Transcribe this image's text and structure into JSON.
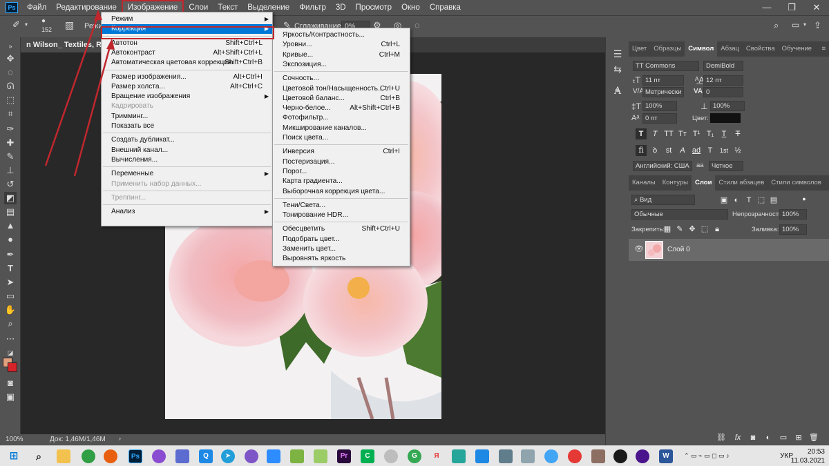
{
  "menubar": {
    "items": [
      "Файл",
      "Редактирование",
      "Изображение",
      "Слои",
      "Текст",
      "Выделение",
      "Фильтр",
      "3D",
      "Просмотр",
      "Окно",
      "Справка"
    ],
    "active_index": 2,
    "logo": "Ps"
  },
  "window_controls": {
    "minimize": "—",
    "maximize": "❐",
    "close": "✕"
  },
  "options_bar": {
    "brush_size": "152",
    "mode_label": "Режим",
    "smoothing_label": "Сглаживание:",
    "smoothing_value": "0%"
  },
  "document_tab": {
    "title": "n Wilson_ Textiles, Rugs, Pil"
  },
  "status_bar": {
    "zoom": "100%",
    "doc_info": "Док: 1,46M/1,46M"
  },
  "image_menu": {
    "items": [
      {
        "label": "Режим",
        "shortcut": "",
        "submenu": true,
        "disabled": false
      },
      {
        "label": "Коррекция",
        "shortcut": "",
        "submenu": true,
        "disabled": false,
        "highlighted": true
      },
      {
        "label": "Автотон",
        "shortcut": "Shift+Ctrl+L",
        "submenu": false,
        "disabled": false
      },
      {
        "label": "Автоконтраст",
        "shortcut": "Alt+Shift+Ctrl+L",
        "submenu": false,
        "disabled": false
      },
      {
        "label": "Автоматическая цветовая коррекция",
        "shortcut": "Shift+Ctrl+B",
        "submenu": false,
        "disabled": false
      },
      {
        "label": "Размер изображения...",
        "shortcut": "Alt+Ctrl+I",
        "submenu": false,
        "disabled": false
      },
      {
        "label": "Размер холста...",
        "shortcut": "Alt+Ctrl+C",
        "submenu": false,
        "disabled": false
      },
      {
        "label": "Вращение изображения",
        "shortcut": "",
        "submenu": true,
        "disabled": false
      },
      {
        "label": "Кадрировать",
        "shortcut": "",
        "submenu": false,
        "disabled": true
      },
      {
        "label": "Тримминг...",
        "shortcut": "",
        "submenu": false,
        "disabled": false
      },
      {
        "label": "Показать все",
        "shortcut": "",
        "submenu": false,
        "disabled": false
      },
      {
        "label": "Создать дубликат...",
        "shortcut": "",
        "submenu": false,
        "disabled": false
      },
      {
        "label": "Внешний канал...",
        "shortcut": "",
        "submenu": false,
        "disabled": false
      },
      {
        "label": "Вычисления...",
        "shortcut": "",
        "submenu": false,
        "disabled": false
      },
      {
        "label": "Переменные",
        "shortcut": "",
        "submenu": true,
        "disabled": false
      },
      {
        "label": "Применить набор данных...",
        "shortcut": "",
        "submenu": false,
        "disabled": true
      },
      {
        "label": "Треппинг...",
        "shortcut": "",
        "submenu": false,
        "disabled": true
      },
      {
        "label": "Анализ",
        "shortcut": "",
        "submenu": true,
        "disabled": false
      }
    ]
  },
  "adjust_menu": {
    "items": [
      {
        "label": "Яркость/Контрастность...",
        "shortcut": ""
      },
      {
        "label": "Уровни...",
        "shortcut": "Ctrl+L"
      },
      {
        "label": "Кривые...",
        "shortcut": "Ctrl+M"
      },
      {
        "label": "Экспозиция...",
        "shortcut": ""
      },
      {
        "label": "Сочность...",
        "shortcut": ""
      },
      {
        "label": "Цветовой тон/Насыщенность...",
        "shortcut": "Ctrl+U"
      },
      {
        "label": "Цветовой баланс...",
        "shortcut": "Ctrl+B"
      },
      {
        "label": "Черно-белое...",
        "shortcut": "Alt+Shift+Ctrl+B"
      },
      {
        "label": "Фотофильтр...",
        "shortcut": ""
      },
      {
        "label": "Микширование каналов...",
        "shortcut": ""
      },
      {
        "label": "Поиск цвета...",
        "shortcut": ""
      },
      {
        "label": "Инверсия",
        "shortcut": "Ctrl+I"
      },
      {
        "label": "Постеризация...",
        "shortcut": ""
      },
      {
        "label": "Порог...",
        "shortcut": ""
      },
      {
        "label": "Карта градиента...",
        "shortcut": ""
      },
      {
        "label": "Выборочная коррекция цвета...",
        "shortcut": ""
      },
      {
        "label": "Тени/Света...",
        "shortcut": ""
      },
      {
        "label": "Тонирование HDR...",
        "shortcut": ""
      },
      {
        "label": "Обесцветить",
        "shortcut": "Shift+Ctrl+U"
      },
      {
        "label": "Подобрать цвет...",
        "shortcut": ""
      },
      {
        "label": "Заменить цвет...",
        "shortcut": ""
      },
      {
        "label": "Выровнять яркость",
        "shortcut": ""
      }
    ]
  },
  "character_panel": {
    "tabs": [
      "Цвет",
      "Образцы",
      "Символ",
      "Абзац",
      "Свойства",
      "Обучение"
    ],
    "active_tab": 2,
    "font_family": "TT Commons",
    "font_style": "DemiBold",
    "font_size": "11 пт",
    "leading": "12 пт",
    "kerning": "Метрически",
    "tracking": "0",
    "vertical_scale": "100%",
    "horizontal_scale": "100%",
    "baseline_shift": "0 пт",
    "color_label": "Цвет:",
    "style_buttons": [
      "T",
      "T",
      "TT",
      "Tт",
      "T¹",
      "T₁",
      "T",
      "T"
    ],
    "opentype_buttons": [
      "fi",
      "ꝺ",
      "st",
      "A",
      "ad",
      "T",
      "1st",
      "½"
    ],
    "language": "Английский: США",
    "antialias_icon": "aа",
    "antialias": "Четкое"
  },
  "layers_panel": {
    "tabs": [
      "Каналы",
      "Контуры",
      "Слои",
      "Стили абзацев",
      "Стили символов"
    ],
    "active_tab": 2,
    "filter_kind": "Вид",
    "blend_mode": "Обычные",
    "opacity_label": "Непрозрачность:",
    "opacity": "100%",
    "lock_label": "Закрепить:",
    "fill_label": "Заливка:",
    "fill": "100%",
    "layers": [
      {
        "name": "Слой 0",
        "visible": true
      }
    ]
  },
  "taskbar": {
    "language": "УКР",
    "time": "20:53",
    "date": "11.03.2021"
  },
  "colors": {
    "foreground": "#e2a07e",
    "background": "#d4242a",
    "highlight": "#0078d7",
    "annotation_red": "#c0272d"
  }
}
